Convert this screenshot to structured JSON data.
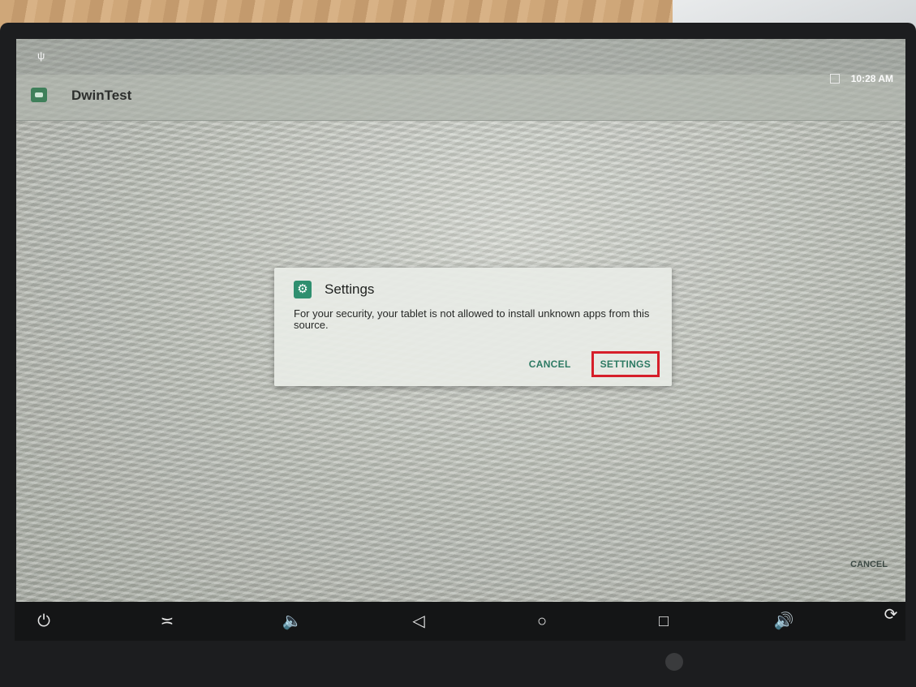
{
  "app": {
    "title": "DwinTest"
  },
  "status_bar": {
    "time": "10:28 AM"
  },
  "dialog": {
    "title": "Settings",
    "message": "For your security, your tablet is not allowed to install unknown apps from this source.",
    "cancel_label": "CANCEL",
    "settings_label": "SETTINGS"
  },
  "background": {
    "cancel_label": "CANCEL"
  },
  "nav_bar": {
    "power_icon": "⏻",
    "collapse_icon": "≍",
    "volume_down_icon": "🔈",
    "back_icon": "◁",
    "home_icon": "○",
    "recents_icon": "□",
    "volume_up_icon": "🔊",
    "rotate_icon": "⟳"
  },
  "colors": {
    "accent": "#2d7a63",
    "highlight": "#d61f2a"
  }
}
